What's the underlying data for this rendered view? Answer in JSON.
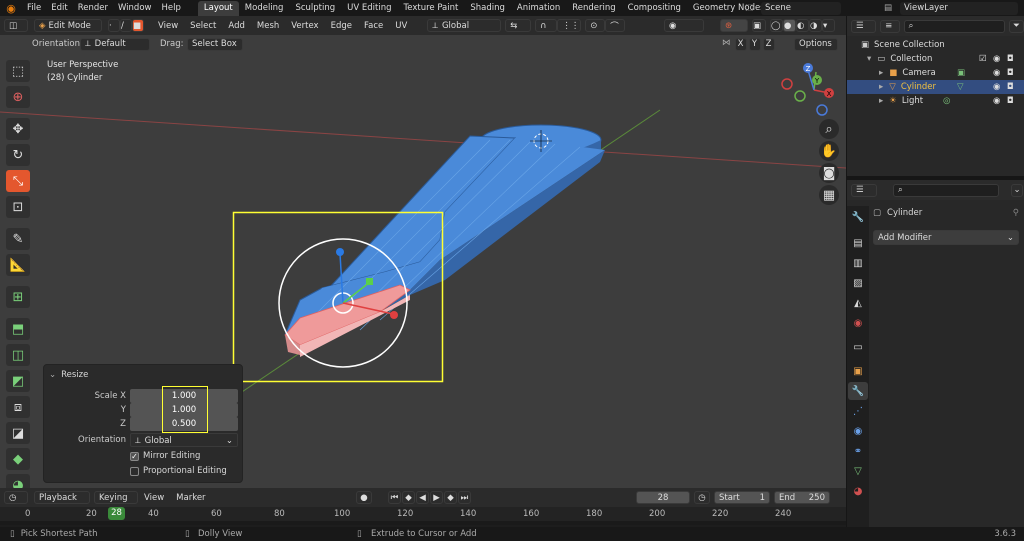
{
  "topbar": {
    "menus": [
      "File",
      "Edit",
      "Render",
      "Window",
      "Help"
    ],
    "workspaces": [
      "Layout",
      "Modeling",
      "Sculpting",
      "UV Editing",
      "Texture Paint",
      "Shading",
      "Animation",
      "Rendering",
      "Compositing",
      "Geometry Nodes"
    ],
    "active_workspace": "Layout",
    "scene": "Scene",
    "view_layer": "ViewLayer"
  },
  "header3d": {
    "mode": "Edit Mode",
    "menus": [
      "View",
      "Select",
      "Add",
      "Mesh",
      "Vertex",
      "Edge",
      "Face",
      "UV"
    ],
    "transform_orientation": "Global",
    "orientation_label": "Orientation:",
    "orientation_value": "Default",
    "drag_label": "Drag:",
    "drag_value": "Select Box",
    "axes": [
      "X",
      "Y",
      "Z"
    ],
    "options": "Options"
  },
  "viewport": {
    "perspective": "User Perspective",
    "object_info": "(28) Cylinder"
  },
  "resize_panel": {
    "title": "Resize",
    "scale_x_label": "Scale X",
    "scale_x": "1.000",
    "y_label": "Y",
    "scale_y": "1.000",
    "z_label": "Z",
    "scale_z": "0.500",
    "orientation_label": "Orientation",
    "orientation_value": "Global",
    "mirror_label": "Mirror Editing",
    "mirror_checked": true,
    "proportional_label": "Proportional Editing",
    "proportional_checked": false
  },
  "timeline": {
    "playback": "Playback",
    "keying": "Keying",
    "view": "View",
    "marker": "Marker",
    "current_frame": "28",
    "start_label": "Start",
    "start": "1",
    "end_label": "End",
    "end": "250",
    "ruler": [
      "0",
      "20",
      "40",
      "60",
      "80",
      "100",
      "120",
      "140",
      "160",
      "180",
      "200",
      "220",
      "240"
    ]
  },
  "statusbar": {
    "left": "Pick Shortest Path",
    "mid": "Dolly View",
    "right": "Extrude to Cursor or Add",
    "version": "3.6.3"
  },
  "outliner": {
    "title": "Scene Collection",
    "collection": "Collection",
    "items": [
      "Camera",
      "Cylinder",
      "Light"
    ]
  },
  "properties": {
    "object_name": "Cylinder",
    "add_modifier": "Add Modifier"
  }
}
